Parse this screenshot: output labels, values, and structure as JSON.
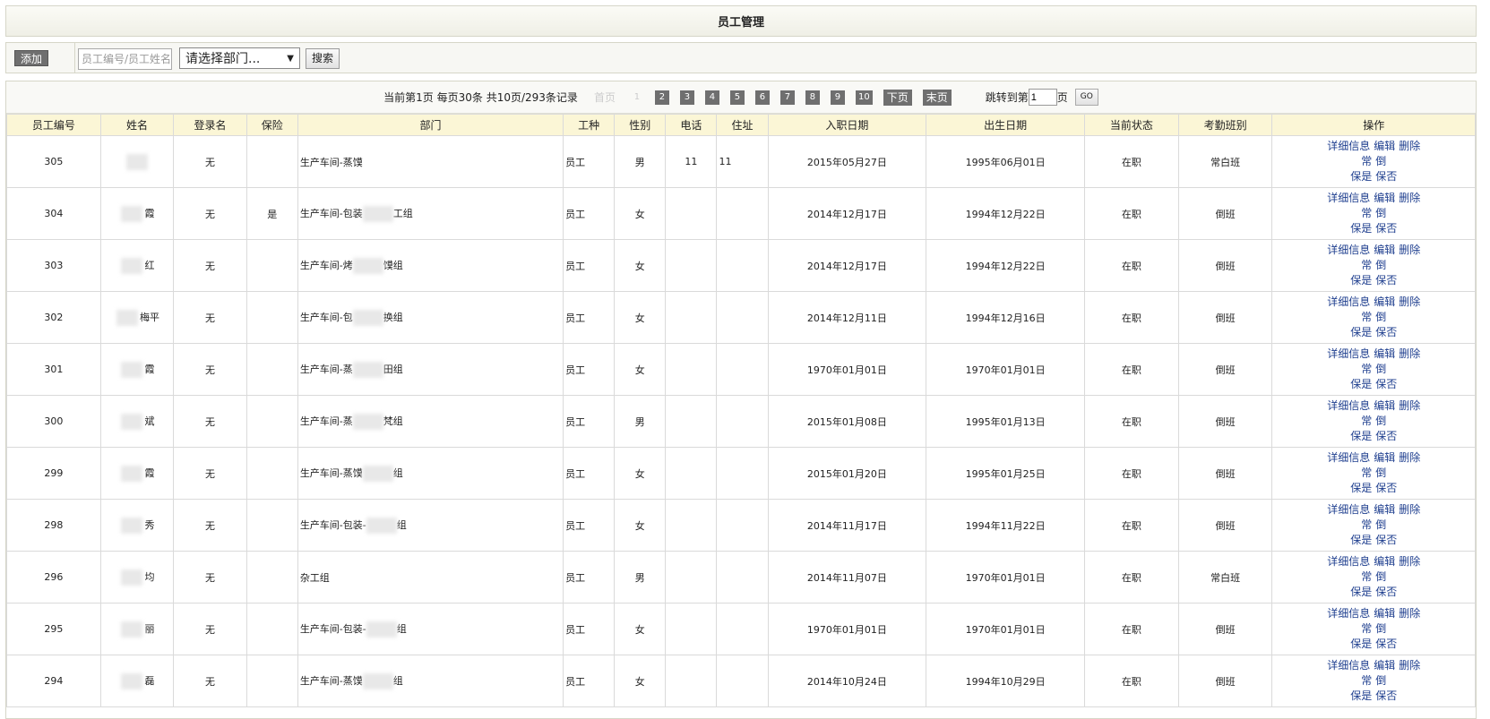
{
  "header": {
    "title": "员工管理"
  },
  "toolbar": {
    "add_label": "添加",
    "search_placeholder": "员工编号/员工姓名",
    "dept_select_value": "请选择部门...",
    "search_label": "搜索"
  },
  "pager": {
    "info": "当前第1页  每页30条  共10页/293条记录",
    "first": "首页",
    "pages": [
      "1",
      "2",
      "3",
      "4",
      "5",
      "6",
      "7",
      "8",
      "9",
      "10"
    ],
    "next": "下页",
    "last": "末页",
    "jump_prefix": "跳转到第",
    "jump_value": "1",
    "jump_suffix": "页",
    "go": "GO"
  },
  "table": {
    "columns": [
      "员工编号",
      "姓名",
      "登录名",
      "保险",
      "部门",
      "工种",
      "性别",
      "电话",
      "住址",
      "入职日期",
      "出生日期",
      "当前状态",
      "考勤班别",
      "操作"
    ],
    "ops": {
      "detail": "详细信息",
      "edit": "编辑",
      "delete": "删除",
      "normal": "常",
      "shift": "倒",
      "ins_yes": "保是",
      "ins_no": "保否"
    },
    "rows": [
      {
        "id": "305",
        "name": "",
        "login": "无",
        "ins": "",
        "dept": "生产车间-蒸馍",
        "type": "员工",
        "sex": "男",
        "phone": "11",
        "addr": "11",
        "hire": "2015年05月27日",
        "birth": "1995年06月01日",
        "status": "在职",
        "shift": "常白班"
      },
      {
        "id": "304",
        "name": "霞",
        "login": "无",
        "ins": "是",
        "dept": "生产车间-包装",
        "dept2": "工组",
        "type": "员工",
        "sex": "女",
        "phone": "",
        "addr": "",
        "hire": "2014年12月17日",
        "birth": "1994年12月22日",
        "status": "在职",
        "shift": "倒班"
      },
      {
        "id": "303",
        "name": "红",
        "login": "无",
        "ins": "",
        "dept": "生产车间-烤",
        "dept2": "馍组",
        "type": "员工",
        "sex": "女",
        "phone": "",
        "addr": "",
        "hire": "2014年12月17日",
        "birth": "1994年12月22日",
        "status": "在职",
        "shift": "倒班"
      },
      {
        "id": "302",
        "name": "梅平",
        "login": "无",
        "ins": "",
        "dept": "生产车间-包",
        "dept2": "换组",
        "type": "员工",
        "sex": "女",
        "phone": "",
        "addr": "",
        "hire": "2014年12月11日",
        "birth": "1994年12月16日",
        "status": "在职",
        "shift": "倒班"
      },
      {
        "id": "301",
        "name": "霞",
        "login": "无",
        "ins": "",
        "dept": "生产车间-蒸",
        "dept2": "田组",
        "type": "员工",
        "sex": "女",
        "phone": "",
        "addr": "",
        "hire": "1970年01月01日",
        "birth": "1970年01月01日",
        "status": "在职",
        "shift": "倒班"
      },
      {
        "id": "300",
        "name": "斌",
        "login": "无",
        "ins": "",
        "dept": "生产车间-蒸",
        "dept2": "梵组",
        "type": "员工",
        "sex": "男",
        "phone": "",
        "addr": "",
        "hire": "2015年01月08日",
        "birth": "1995年01月13日",
        "status": "在职",
        "shift": "倒班"
      },
      {
        "id": "299",
        "name": "霞",
        "login": "无",
        "ins": "",
        "dept": "生产车间-蒸馍",
        "dept2": "组",
        "type": "员工",
        "sex": "女",
        "phone": "",
        "addr": "",
        "hire": "2015年01月20日",
        "birth": "1995年01月25日",
        "status": "在职",
        "shift": "倒班"
      },
      {
        "id": "298",
        "name": "秀",
        "login": "无",
        "ins": "",
        "dept": "生产车间-包装-",
        "dept2": "组",
        "type": "员工",
        "sex": "女",
        "phone": "",
        "addr": "",
        "hire": "2014年11月17日",
        "birth": "1994年11月22日",
        "status": "在职",
        "shift": "倒班"
      },
      {
        "id": "296",
        "name": "均",
        "login": "无",
        "ins": "",
        "dept": "杂工组",
        "type": "员工",
        "sex": "男",
        "phone": "",
        "addr": "",
        "hire": "2014年11月07日",
        "birth": "1970年01月01日",
        "status": "在职",
        "shift": "常白班"
      },
      {
        "id": "295",
        "name": "丽",
        "login": "无",
        "ins": "",
        "dept": "生产车间-包装-",
        "dept2": "组",
        "type": "员工",
        "sex": "女",
        "phone": "",
        "addr": "",
        "hire": "1970年01月01日",
        "birth": "1970年01月01日",
        "status": "在职",
        "shift": "倒班"
      },
      {
        "id": "294",
        "name": "磊",
        "login": "无",
        "ins": "",
        "dept": "生产车间-蒸馍",
        "dept2": "组",
        "type": "员工",
        "sex": "女",
        "phone": "",
        "addr": "",
        "hire": "2014年10月24日",
        "birth": "1994年10月29日",
        "status": "在职",
        "shift": "倒班"
      }
    ]
  }
}
